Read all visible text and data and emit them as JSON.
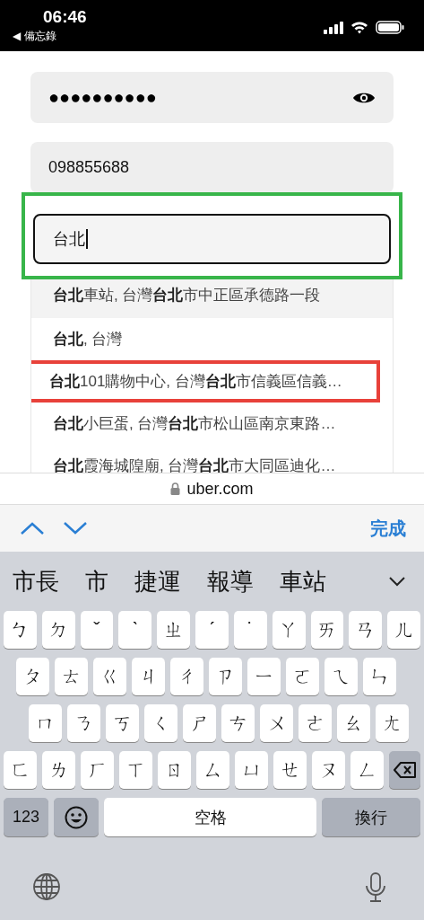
{
  "status_bar": {
    "time": "06:46",
    "back_label": "◀ 備忘錄"
  },
  "form": {
    "password": {
      "value": "●●●●●●●●●●"
    },
    "phone": {
      "value": "098855688"
    },
    "address": {
      "value": "台北",
      "focused": true,
      "outlined": true
    }
  },
  "suggestions": [
    {
      "text": "**台北**車站, 台灣**台北**市中正區承德路一段",
      "selected": true,
      "outlined": false
    },
    {
      "text": "**台北**, 台灣",
      "selected": false,
      "outlined": false
    },
    {
      "text": "**台北**101購物中心, 台灣**台北**市信義區信義…",
      "selected": false,
      "outlined": true
    },
    {
      "text": "**台北**小巨蛋, 台灣**台北**市松山區南京東路…",
      "selected": false,
      "outlined": false
    },
    {
      "text": "**台北**霞海城隍廟, 台灣**台北**市大同區迪化…",
      "selected": false,
      "outlined": false
    }
  ],
  "address_bar": {
    "url": "uber.com"
  },
  "toolbar": {
    "done": "完成"
  },
  "keyboard": {
    "candidates": [
      "市長",
      "市",
      "捷運",
      "報導",
      "車站"
    ],
    "rows": [
      [
        "ㄅ",
        "ㄉ",
        "ˇ",
        "ˋ",
        "ㄓ",
        "ˊ",
        "˙",
        "ㄚ",
        "ㄞ",
        "ㄢ",
        "ㄦ"
      ],
      [
        "ㄆ",
        "ㄊ",
        "ㄍ",
        "ㄐ",
        "ㄔ",
        "ㄗ",
        "ㄧ",
        "ㄛ",
        "ㄟ",
        "ㄣ"
      ],
      [
        "ㄇ",
        "ㄋ",
        "ㄎ",
        "ㄑ",
        "ㄕ",
        "ㄘ",
        "ㄨ",
        "ㄜ",
        "ㄠ",
        "ㄤ"
      ],
      [
        "ㄈ",
        "ㄌ",
        "ㄏ",
        "ㄒ",
        "ㄖ",
        "ㄙ",
        "ㄩ",
        "ㄝ",
        "ㄡ",
        "ㄥ"
      ]
    ],
    "numbers_key": "123",
    "space_key": "空格",
    "return_key": "換行"
  }
}
